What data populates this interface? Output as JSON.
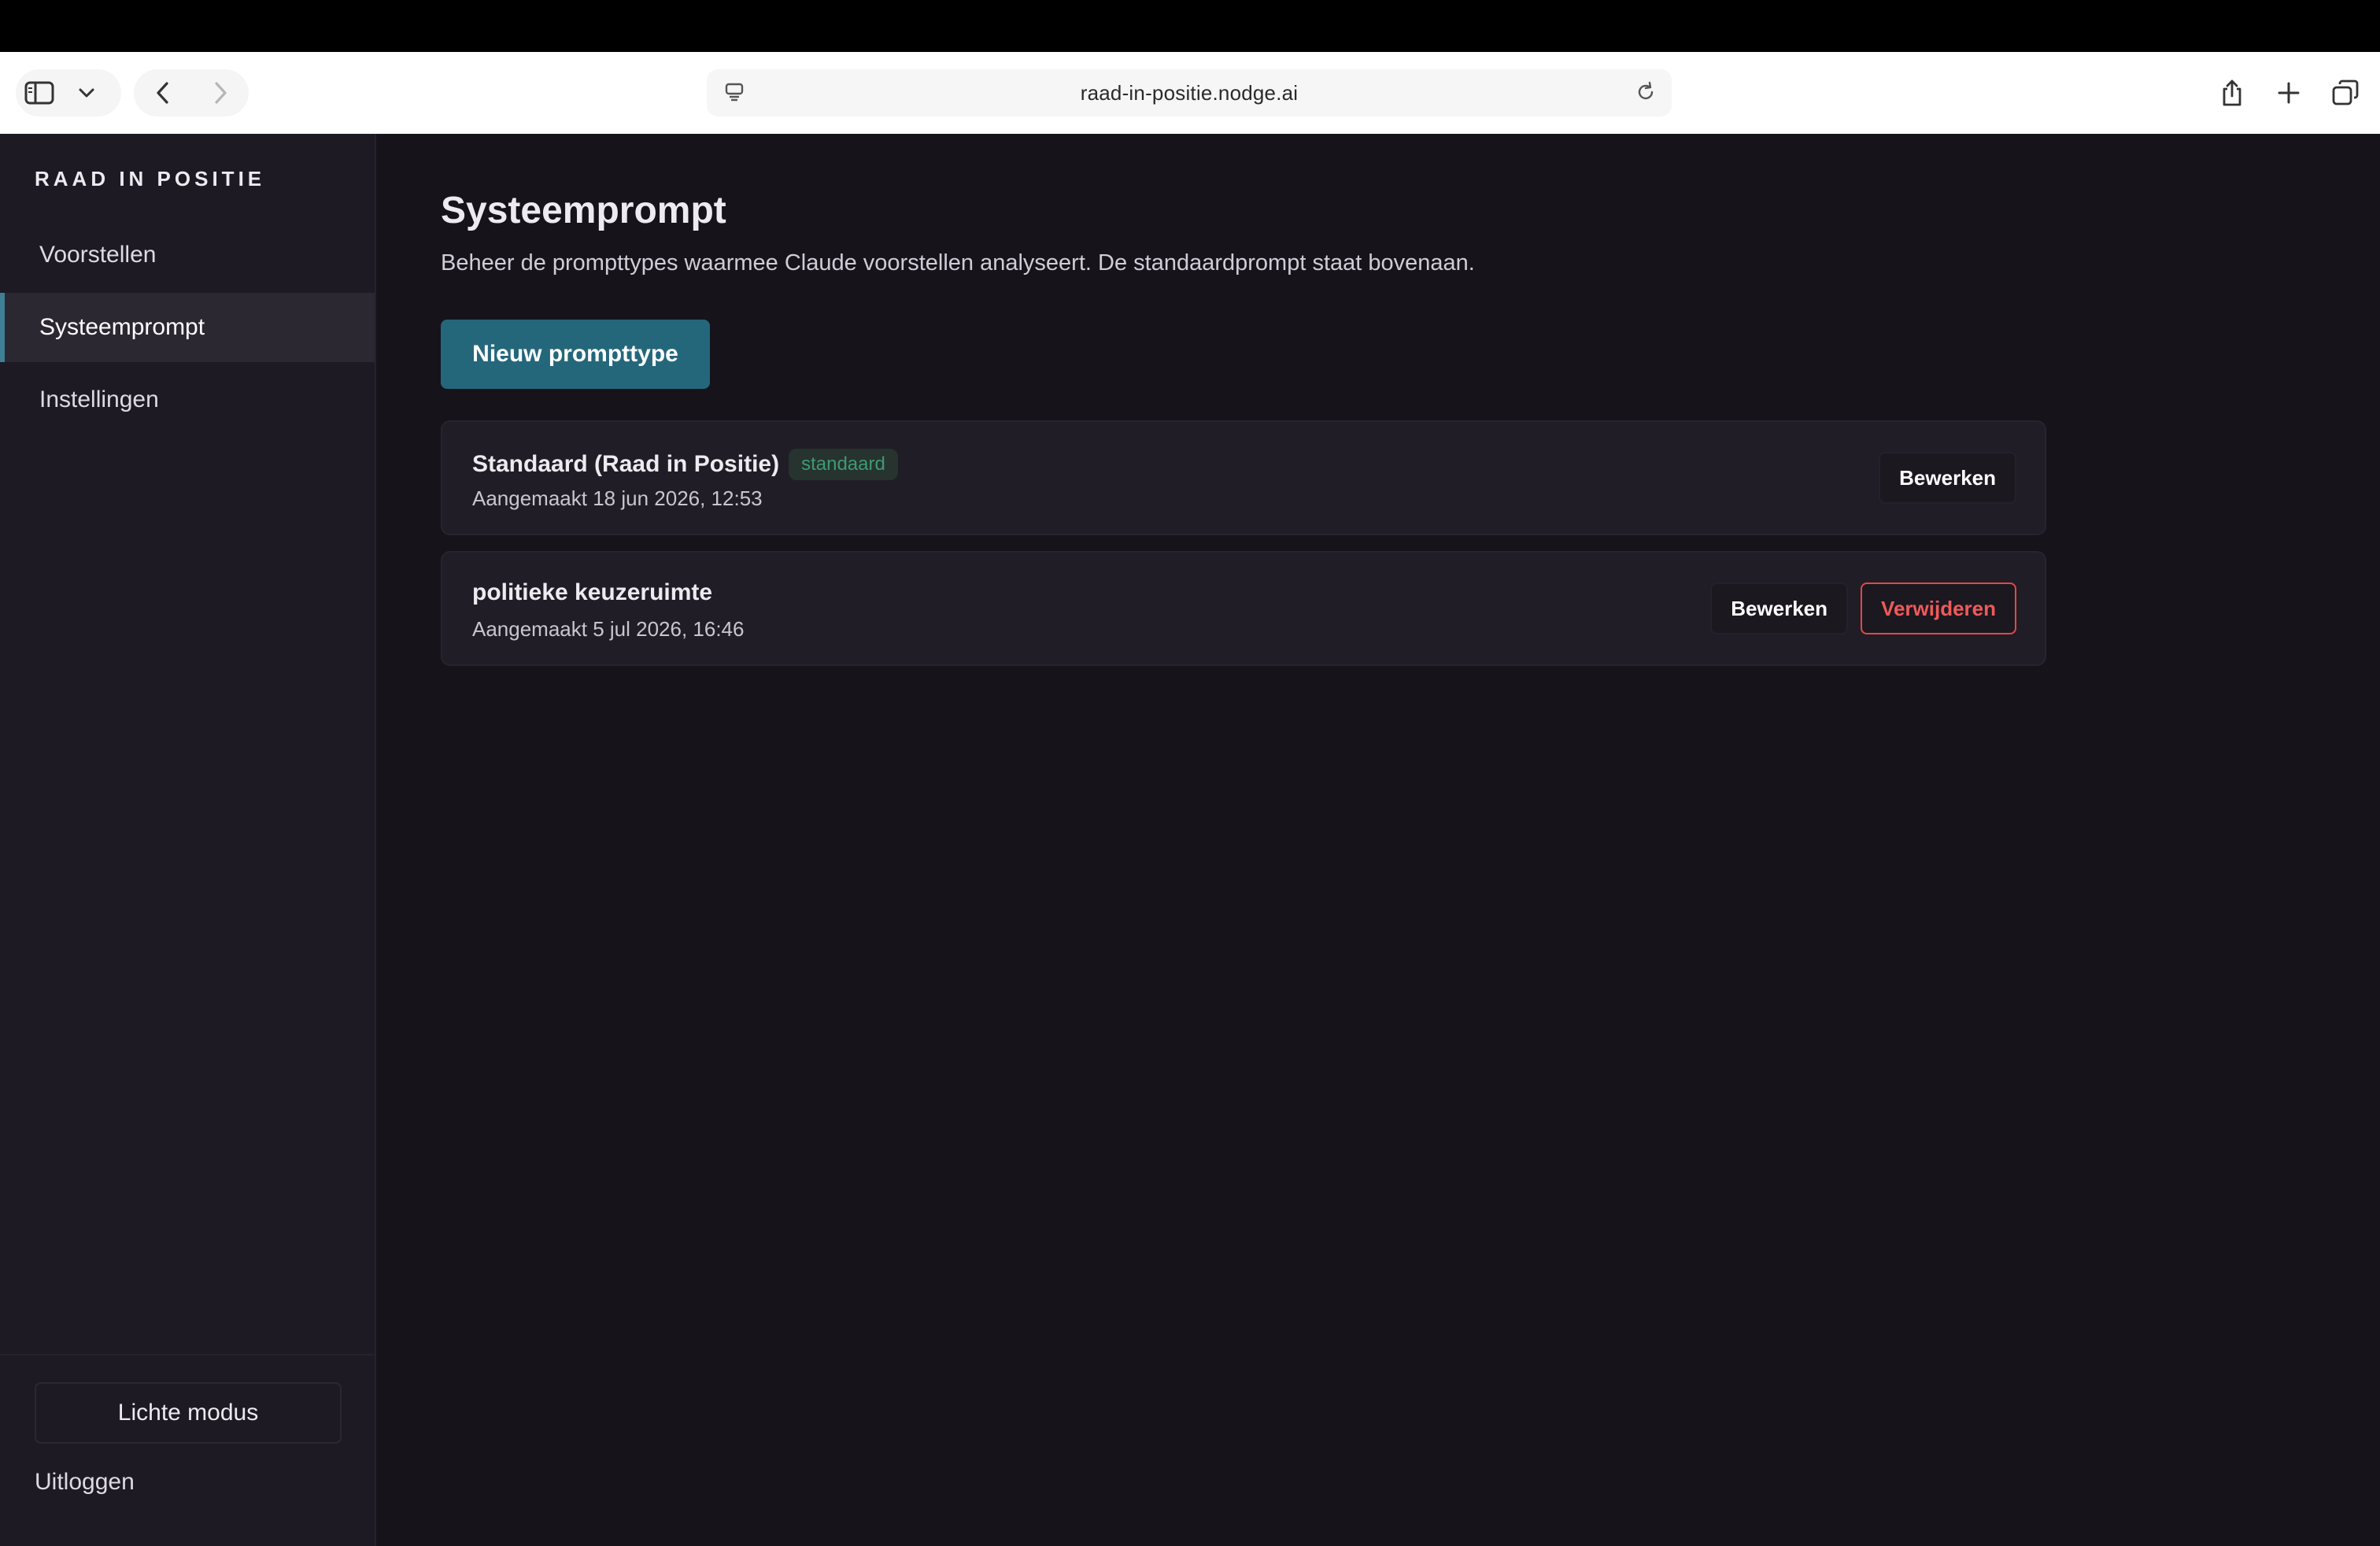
{
  "browser": {
    "url": "raad-in-positie.nodge.ai"
  },
  "sidebar": {
    "brand": "RAAD IN POSITIE",
    "items": [
      {
        "label": "Voorstellen",
        "active": false
      },
      {
        "label": "Systeemprompt",
        "active": true
      },
      {
        "label": "Instellingen",
        "active": false
      }
    ],
    "theme_toggle": "Lichte modus",
    "logout": "Uitloggen"
  },
  "main": {
    "title": "Systeemprompt",
    "description": "Beheer de prompttypes waarmee Claude voorstellen analyseert. De standaardprompt staat bovenaan.",
    "new_button": "Nieuw prompttype",
    "prompts": [
      {
        "name": "Standaard (Raad in Positie)",
        "badge": "standaard",
        "created": "Aangemaakt 18 jun 2026, 12:53",
        "edit_label": "Bewerken"
      },
      {
        "name": "politieke keuzeruimte",
        "created": "Aangemaakt 5 jul 2026, 16:46",
        "edit_label": "Bewerken",
        "delete_label": "Verwijderen"
      }
    ]
  },
  "colors": {
    "accent": "#24677b",
    "danger": "#e0494a",
    "badge_text": "#3f9a72",
    "background": "#16131b",
    "sidebar": "#1d1a24"
  }
}
